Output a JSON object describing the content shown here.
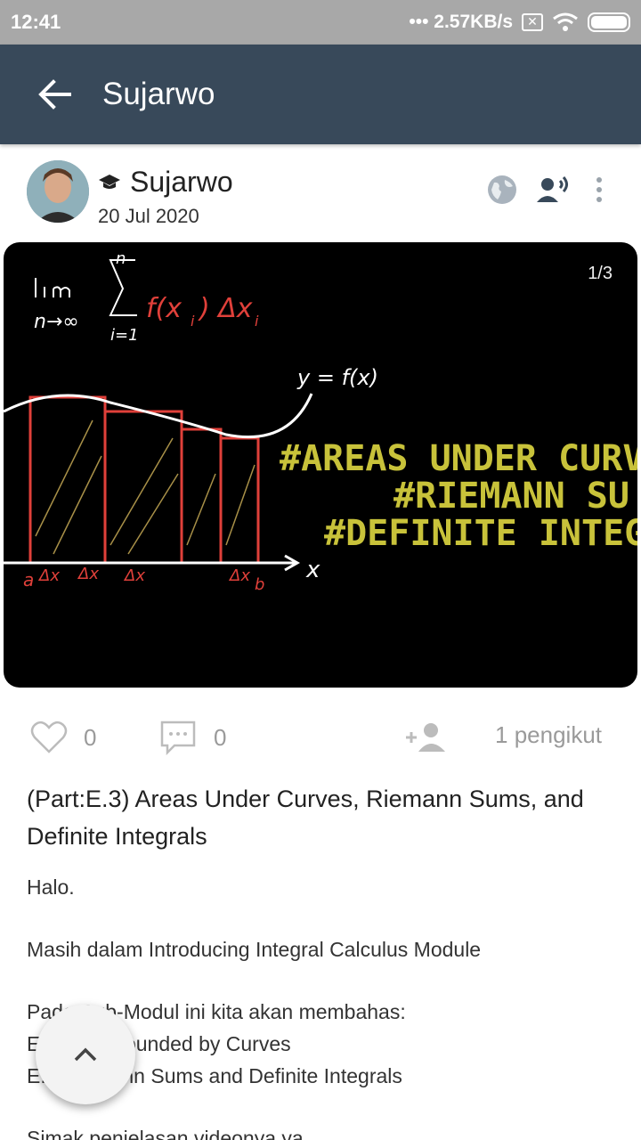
{
  "status_bar": {
    "time": "12:41",
    "network_speed": "••• 2.57KB/s",
    "icons": [
      "sim-x-icon",
      "wifi-icon",
      "battery-icon"
    ]
  },
  "app_bar": {
    "title": "Sujarwo",
    "back_icon": "arrow-left-icon",
    "background": "#38495a"
  },
  "post": {
    "author": "Sujarwo",
    "date": "20 Jul 2020",
    "author_badge_icon": "graduation-cap-icon",
    "visibility_icon": "globe-icon",
    "audience_icon": "speaker-person-icon",
    "menu_icon": "more-vertical-icon",
    "media": {
      "counter": "1/3",
      "math_formula": "lim n→∞ Σ i=1..n f(xi) Δxi",
      "curve_label": "y = f(x)",
      "axis_label": "x",
      "interval_labels": [
        "a",
        "Δx1",
        "Δx2",
        "Δx3",
        "Δxn",
        "b"
      ],
      "hashtags": [
        "#AREAS UNDER CURV",
        "#RIEMANN SU",
        "#DEFINITE INTEGR"
      ],
      "hashtag_color": "#c8c23a",
      "rectangle_color": "#e0403a"
    },
    "likes": "0",
    "comments": "0",
    "followers": "1 pengikut",
    "title": "(Part:E.3) Areas Under Curves, Riemann Sums, and Definite Integrals",
    "body": {
      "line1": "Halo.",
      "line2": "Masih dalam Introducing Integral Calculus Module",
      "line3": "Pada Sub-Modul ini kita akan membahas:",
      "line4": "E.1 Area Bounded by Curves",
      "line5": "E.2 Riemann Sums and Definite Integrals",
      "line6": "Simak penjelasan videonya ya"
    }
  },
  "fab": {
    "icon": "chevron-up-icon"
  }
}
